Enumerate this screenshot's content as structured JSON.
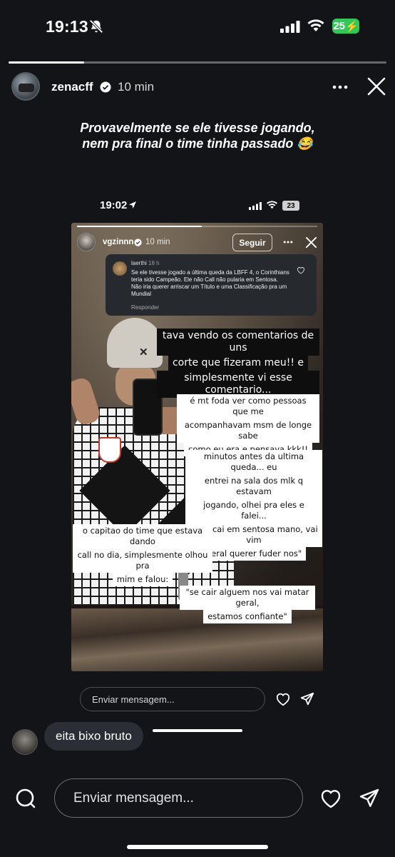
{
  "status_bar": {
    "time": "19:13",
    "battery": "25",
    "battery_color": "#33c759",
    "icons": [
      "mute-icon",
      "signal-icon",
      "wifi-icon"
    ]
  },
  "story": {
    "progress": 0.2,
    "username": "zenacff",
    "verified": true,
    "time_ago": "10 min",
    "caption": "Provavelmente se ele tivesse jogando, nem pra final o time tinha passado 😂"
  },
  "inner_status_bar": {
    "time": "19:02",
    "battery": "23"
  },
  "inner_story": {
    "progress": 0.52,
    "username": "vgzinnn",
    "time_ago": "10 min",
    "follow_label": "Seguir",
    "comment": {
      "user": "laerthi",
      "time": "18 h",
      "text": "Se ele tivesse jogado a última queda da LBFF 4, o Corinthians teria sido Campeão. Ele não Call não pularia em Sentosa. Não iria querer arriscar um Título e uma Classificação pra um Mundial",
      "reply_label": "Responder"
    },
    "stickers": {
      "s1": [
        "tava vendo os comentarios de uns",
        "corte que fizeram meu!! e",
        "simplesmente vi esse comentario..."
      ],
      "s2": [
        "é mt foda ver como pessoas que me",
        "acompanhavam msm de longe sabe",
        "como eu era e pensava kkk!!"
      ],
      "s3": [
        "minutos antes da ultima queda... eu",
        "entrei na sala dos mlk q estavam",
        "jogando, olhei pra eles e falei...",
        "\"Não cai em sentosa mano, vai vim",
        "geral querer fuder nos\""
      ],
      "s4": [
        "o capitao do time que estava dando",
        "call no dia, simplesmente olhou pra",
        "mim e falou:"
      ],
      "s5": [
        "\"se cair alguem nos vai matar geral,",
        "estamos confiante\""
      ]
    },
    "message_placeholder": "Enviar mensagem..."
  },
  "reply": {
    "text": "eita bixo bruto"
  },
  "bottom_bar": {
    "message_placeholder": "Enviar mensagem..."
  }
}
